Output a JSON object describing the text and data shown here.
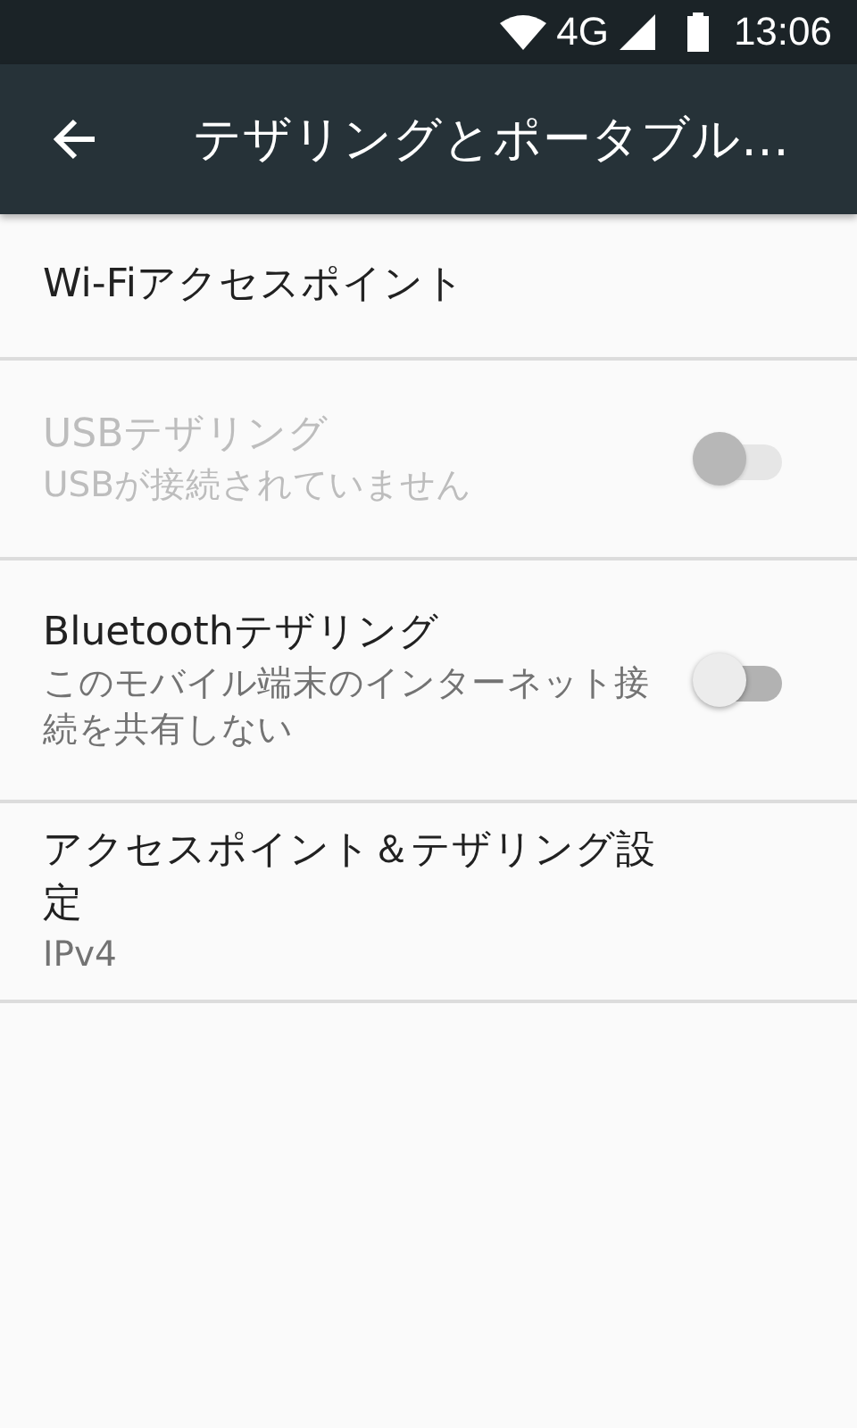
{
  "status_bar": {
    "network": "4G",
    "time": "13:06"
  },
  "toolbar": {
    "title": "テザリングとポータブル…"
  },
  "items": [
    {
      "kind": "plain",
      "title": "Wi-Fiアクセスポイント",
      "disabled": false
    },
    {
      "kind": "switch",
      "title": "USBテザリング",
      "summary": "USBが接続されていません",
      "disabled": true,
      "on": false
    },
    {
      "kind": "switch",
      "title": "Bluetoothテザリング",
      "summary": "このモバイル端末のインターネット接続を共有しない",
      "disabled": false,
      "on": false
    },
    {
      "kind": "plain",
      "title": "アクセスポイント＆テザリング設定",
      "summary": "IPv4",
      "disabled": false
    }
  ]
}
